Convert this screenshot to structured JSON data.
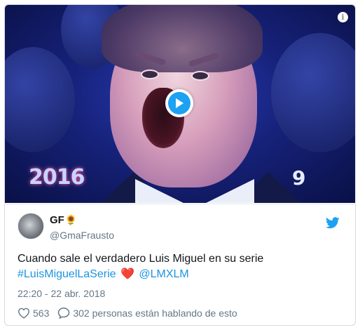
{
  "media": {
    "overlay_left_text": "2016",
    "overlay_right_text": "9"
  },
  "tweet": {
    "display_name": "GF",
    "name_emoji": "🌻",
    "handle": "@GmaFrausto",
    "text_line1": "Cuando sale el verdadero Luis Miguel en su serie",
    "hashtag": "#LuisMiguelLaSerie",
    "heart_emoji": "❤️",
    "mention": "@LMXLM",
    "timestamp": "22:20 - 22 abr. 2018",
    "likes_count": "563",
    "replies_text": "302 personas están hablando de esto"
  },
  "colors": {
    "link": "#1b95e0",
    "twitter_blue": "#1da1f2",
    "muted": "#657786",
    "heart": "#e0245e"
  },
  "icons": [
    "info-icon",
    "play-icon",
    "twitter-bird-icon",
    "heart-icon",
    "reply-bubble-icon"
  ]
}
